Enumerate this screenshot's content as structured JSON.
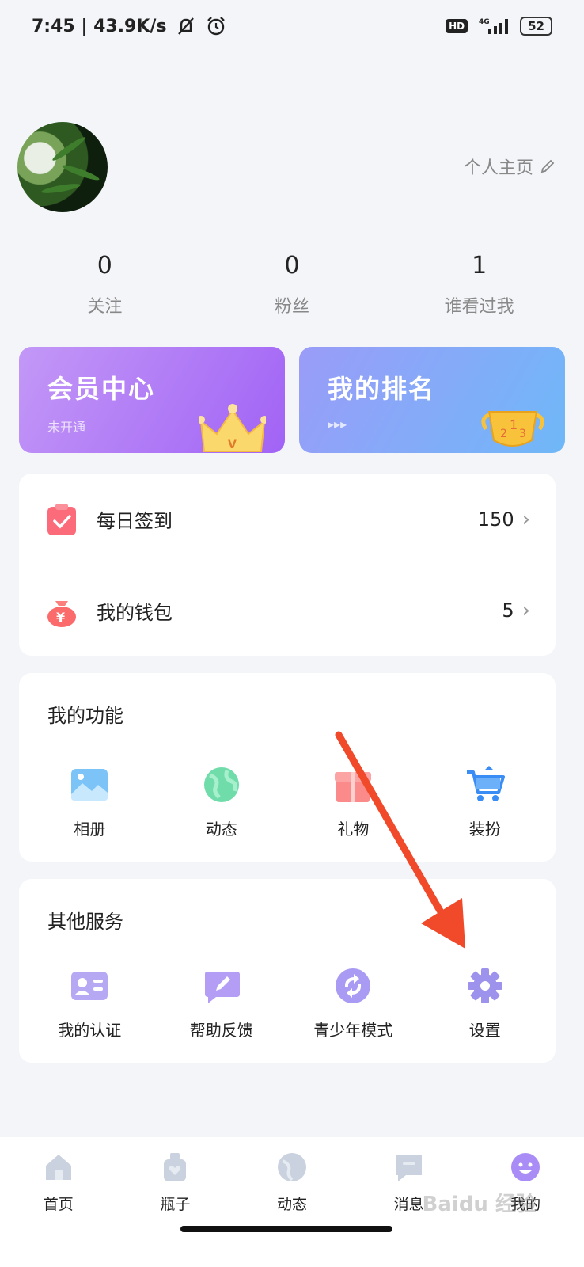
{
  "status_bar": {
    "time_speed": "7:45 | 43.9K/s",
    "hd_label": "HD",
    "network": "4G",
    "battery": "52"
  },
  "profile": {
    "homepage_link": "个人主页"
  },
  "stats": [
    {
      "count": "0",
      "label": "关注"
    },
    {
      "count": "0",
      "label": "粉丝"
    },
    {
      "count": "1",
      "label": "谁看过我"
    }
  ],
  "promo_cards": {
    "vip": {
      "title": "会员中心",
      "subtitle": "未开通"
    },
    "rank": {
      "title": "我的排名",
      "subtitle": "▸▸▸"
    }
  },
  "list": {
    "checkin": {
      "label": "每日签到",
      "value": "150"
    },
    "wallet": {
      "label": "我的钱包",
      "value": "5"
    }
  },
  "my_functions": {
    "title": "我的功能",
    "items": [
      {
        "label": "相册",
        "icon": "album-icon"
      },
      {
        "label": "动态",
        "icon": "globe-icon"
      },
      {
        "label": "礼物",
        "icon": "gift-icon"
      },
      {
        "label": "装扮",
        "icon": "cart-icon"
      }
    ]
  },
  "other_services": {
    "title": "其他服务",
    "items": [
      {
        "label": "我的认证",
        "icon": "id-card-icon"
      },
      {
        "label": "帮助反馈",
        "icon": "feedback-icon"
      },
      {
        "label": "青少年模式",
        "icon": "teen-mode-icon"
      },
      {
        "label": "设置",
        "icon": "gear-icon"
      }
    ]
  },
  "tabbar": {
    "items": [
      {
        "label": "首页",
        "icon": "home-icon"
      },
      {
        "label": "瓶子",
        "icon": "bottle-icon"
      },
      {
        "label": "动态",
        "icon": "planet-icon"
      },
      {
        "label": "消息",
        "icon": "message-icon"
      },
      {
        "label": "我的",
        "icon": "smiley-icon"
      }
    ],
    "active_color": "#a98cf5"
  },
  "watermark": "Baidu 经验",
  "colors": {
    "arrow": "#f04a2a",
    "vip_gradient": [
      "#c398f7",
      "#a163f5"
    ],
    "rank_gradient": [
      "#9a9cf8",
      "#6fb8f8"
    ]
  }
}
